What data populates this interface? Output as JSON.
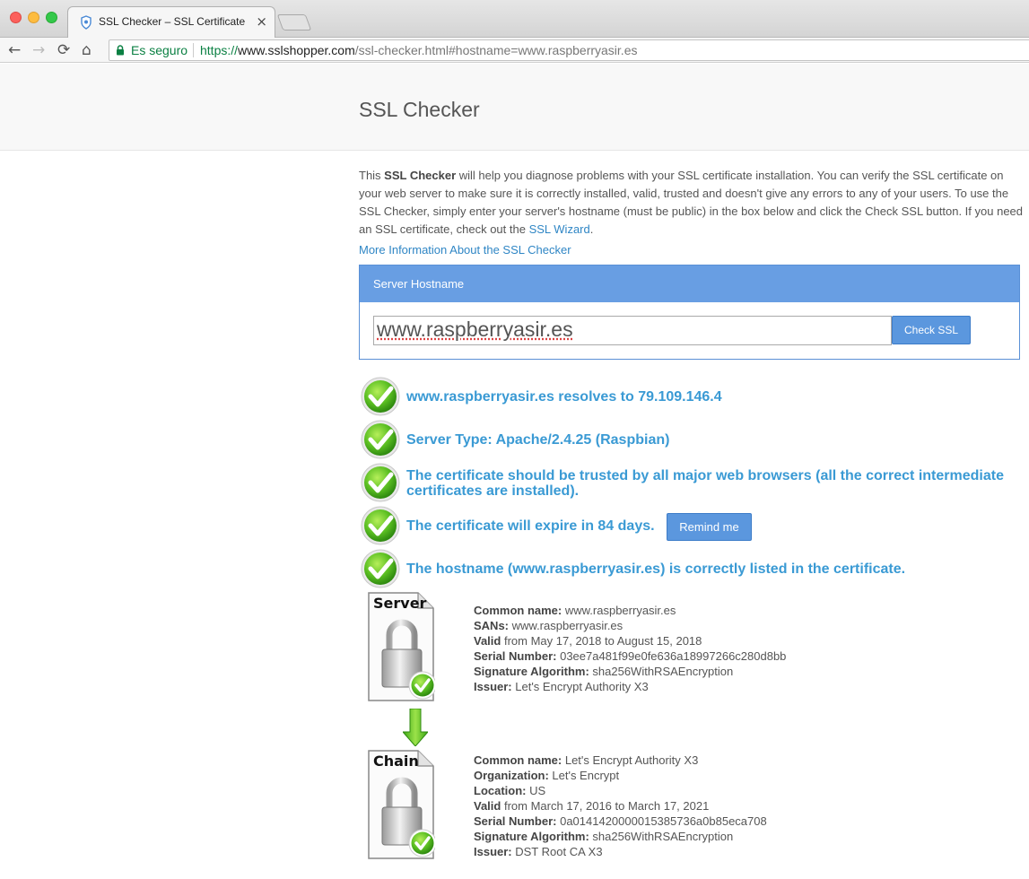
{
  "browser": {
    "tab_title": "SSL Checker – SSL Certificate",
    "tab_close": "×",
    "secure_label": "Es seguro",
    "url_scheme": "https://",
    "url_host": "www.sslshopper.com",
    "url_path": "/ssl-checker.html#hostname=www.raspberryasir.es",
    "nav": {
      "back": "←",
      "forward": "→",
      "reload": "⟳",
      "home": "⌂"
    }
  },
  "page": {
    "title": "SSL Checker",
    "intro_bold": "SSL Checker",
    "intro_before": "This ",
    "intro_after": " will help you diagnose problems with your SSL certificate installation. You can verify the SSL certificate on your web server to make sure it is correctly installed, valid, trusted and doesn't give any errors to any of your users. To use the SSL Checker, simply enter your server's hostname (must be public) in the box below and click the Check SSL button. If you need an SSL certificate, check out the ",
    "intro_link": "SSL Wizard",
    "intro_end": ".",
    "more_info_link": "More Information About the SSL Checker",
    "form_header": "Server Hostname",
    "hostname_value": "www.raspberryasir.es",
    "check_button": "Check SSL"
  },
  "results": [
    "www.raspberryasir.es resolves to 79.109.146.4",
    "Server Type: Apache/2.4.25 (Raspbian)",
    "The certificate should be trusted by all major web browsers (all the correct intermediate certificates are installed).",
    "The certificate will expire in 84 days.",
    "The hostname (www.raspberryasir.es) is correctly listed in the certificate."
  ],
  "remind_button": "Remind me",
  "server_cert": {
    "icon_label": "Server",
    "fields": [
      {
        "label": "Common name:",
        "value": " www.raspberryasir.es"
      },
      {
        "label": "SANs:",
        "value": " www.raspberryasir.es"
      },
      {
        "label": "Valid",
        "value": " from May 17, 2018 to August 15, 2018"
      },
      {
        "label": "Serial Number:",
        "value": " 03ee7a481f99e0fe636a18997266c280d8bb"
      },
      {
        "label": "Signature Algorithm:",
        "value": " sha256WithRSAEncryption"
      },
      {
        "label": "Issuer:",
        "value": " Let's Encrypt Authority X3"
      }
    ]
  },
  "chain_cert": {
    "icon_label": "Chain",
    "fields": [
      {
        "label": "Common name:",
        "value": " Let's Encrypt Authority X3"
      },
      {
        "label": "Organization:",
        "value": " Let's Encrypt"
      },
      {
        "label": "Location:",
        "value": " US"
      },
      {
        "label": "Valid",
        "value": " from March 17, 2016 to March 17, 2021"
      },
      {
        "label": "Serial Number:",
        "value": " 0a0141420000015385736a0b85eca708"
      },
      {
        "label": "Signature Algorithm:",
        "value": " sha256WithRSAEncryption"
      },
      {
        "label": "Issuer:",
        "value": " DST Root CA X3"
      }
    ]
  },
  "colors": {
    "accent": "#3a9ad4",
    "button": "#5b97de",
    "header": "#689ee3",
    "check": "#4caf1f"
  },
  "icons": [
    "shield-icon",
    "lock-icon",
    "check-icon",
    "certificate-icon",
    "arrow-down-icon"
  ]
}
